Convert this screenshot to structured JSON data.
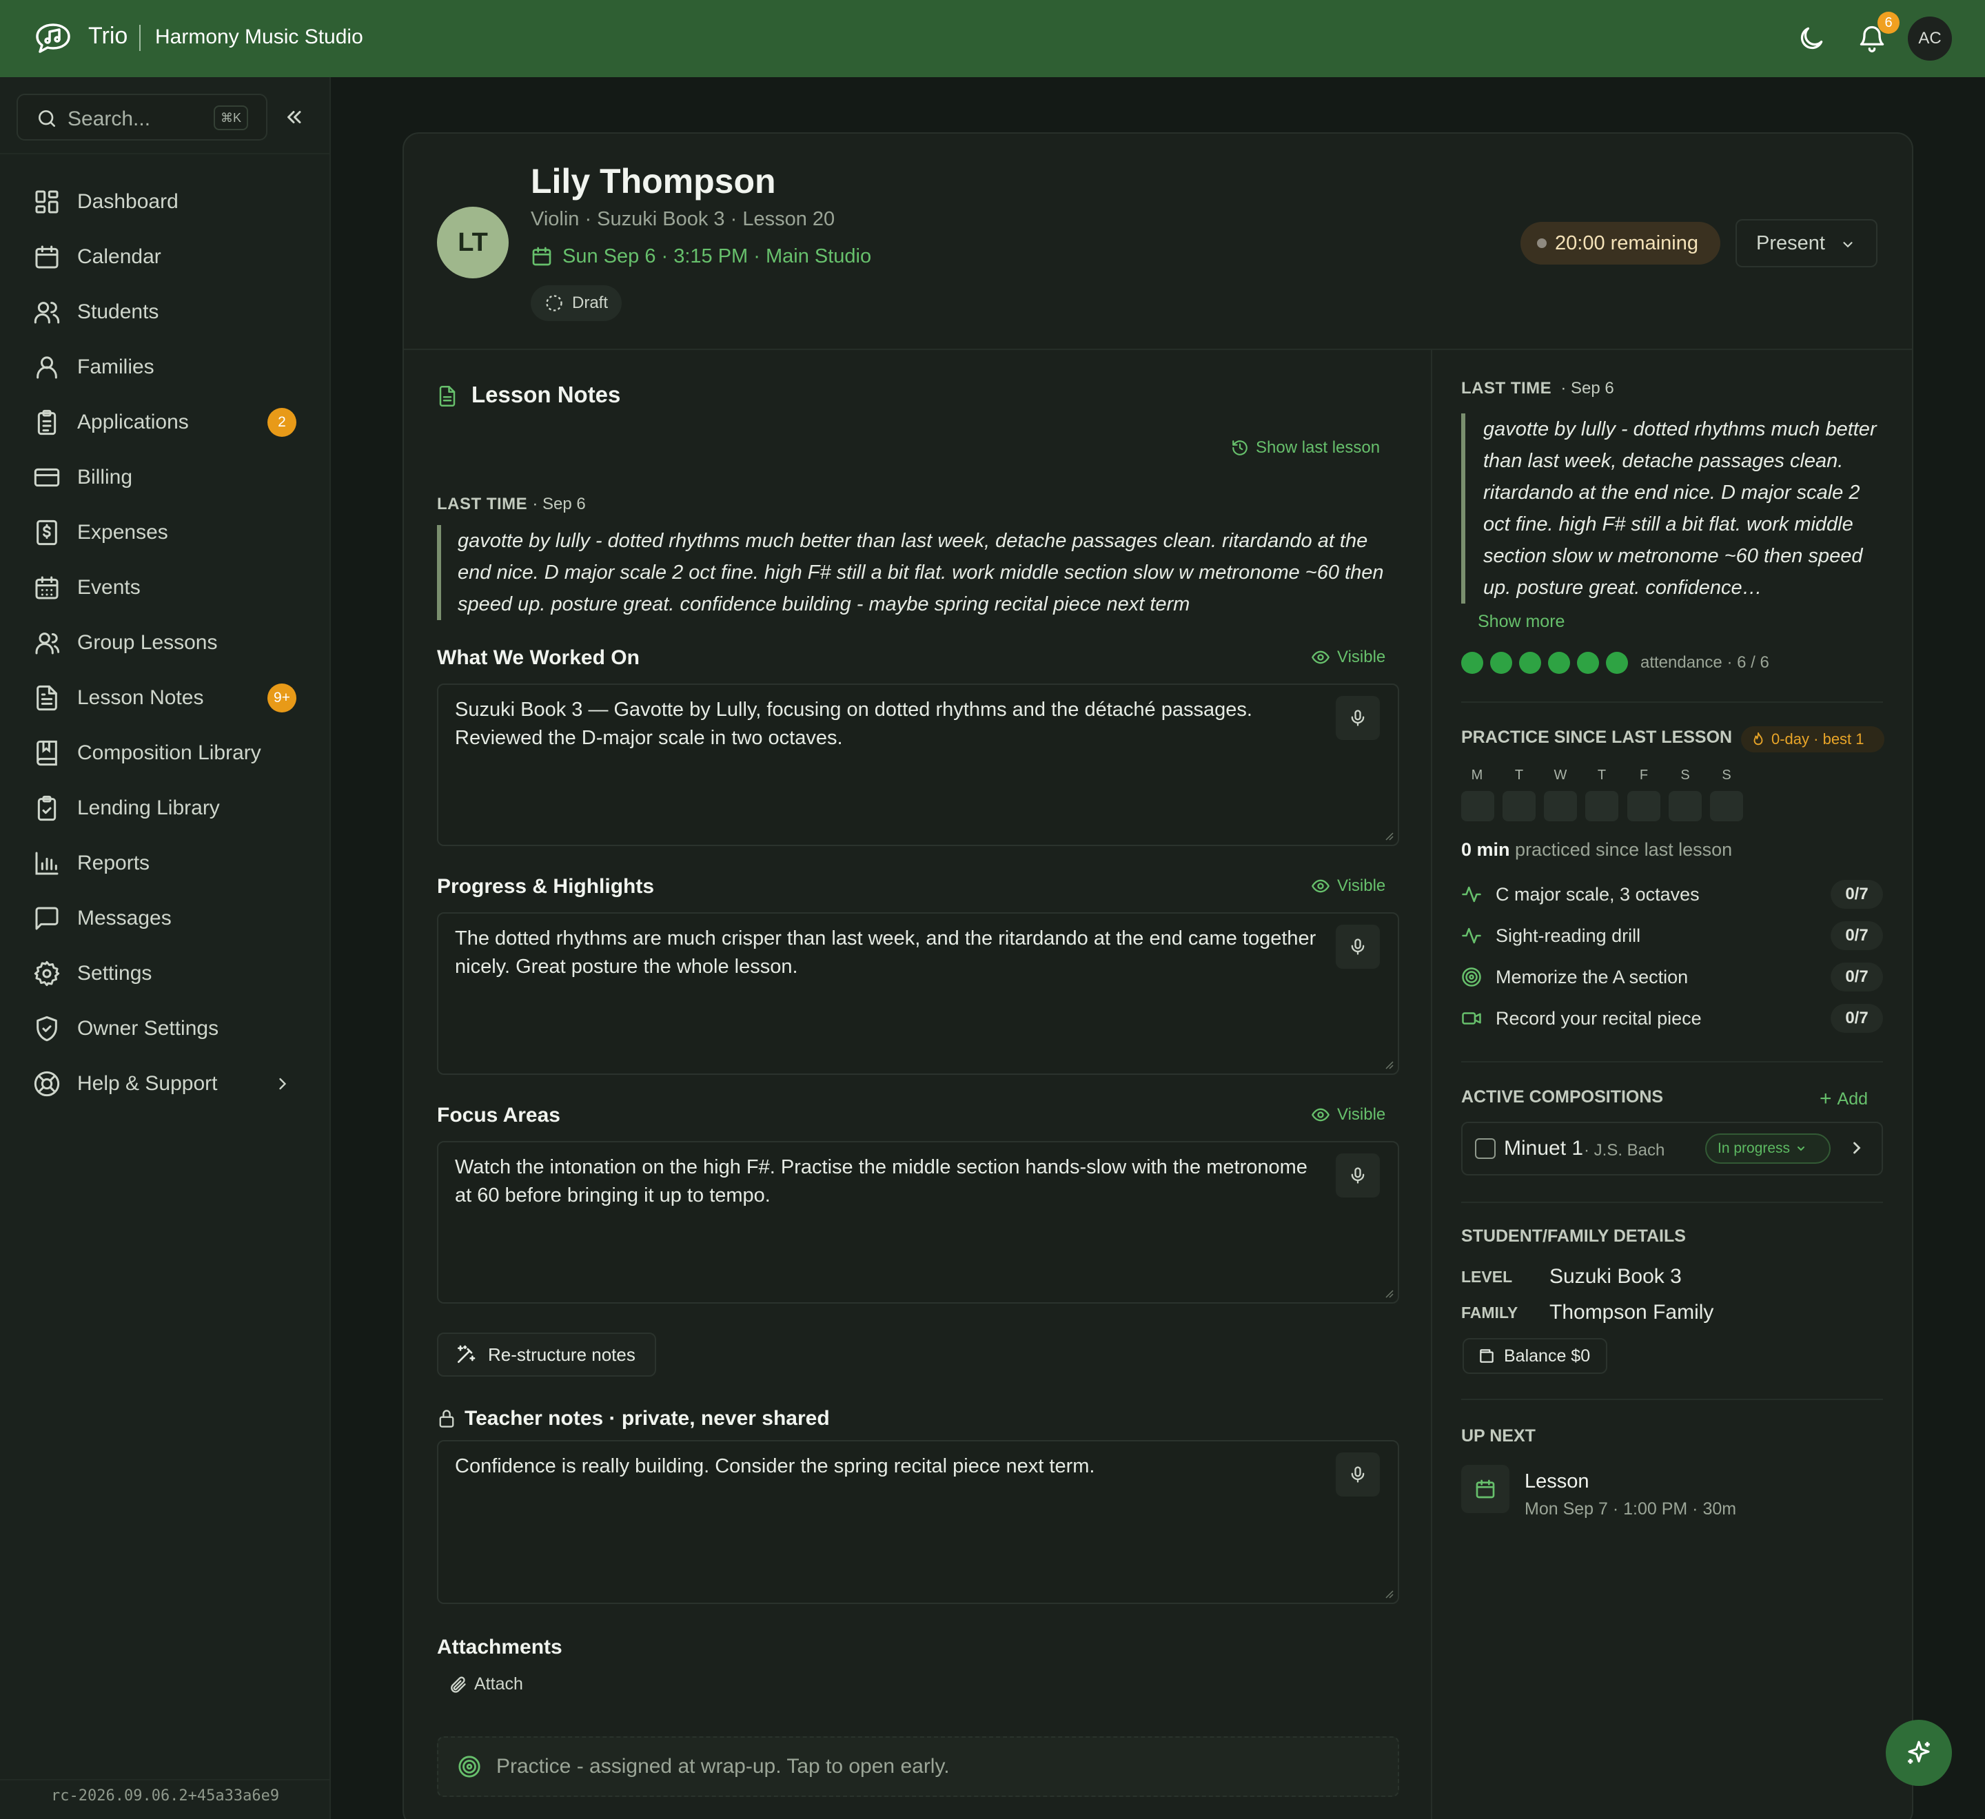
{
  "topbar": {
    "brand": "Trio",
    "studio": "Harmony Music Studio",
    "notification_count": "6",
    "avatar_initials": "AC"
  },
  "sidebar": {
    "search_placeholder": "Search...",
    "search_shortcut": "⌘K",
    "items": [
      {
        "label": "Dashboard",
        "icon": "dashboard-icon"
      },
      {
        "label": "Calendar",
        "icon": "calendar-icon"
      },
      {
        "label": "Students",
        "icon": "users-icon"
      },
      {
        "label": "Families",
        "icon": "user-icon"
      },
      {
        "label": "Applications",
        "icon": "clipboard-icon",
        "badge": "2"
      },
      {
        "label": "Billing",
        "icon": "credit-card-icon"
      },
      {
        "label": "Expenses",
        "icon": "receipt-icon"
      },
      {
        "label": "Events",
        "icon": "calendar-grid-icon"
      },
      {
        "label": "Group Lessons",
        "icon": "group-icon"
      },
      {
        "label": "Lesson Notes",
        "icon": "notes-icon",
        "badge": "9+"
      },
      {
        "label": "Composition Library",
        "icon": "book-icon"
      },
      {
        "label": "Lending Library",
        "icon": "clipboard-check-icon"
      },
      {
        "label": "Reports",
        "icon": "bar-chart-icon"
      },
      {
        "label": "Messages",
        "icon": "message-icon"
      },
      {
        "label": "Settings",
        "icon": "gear-icon"
      },
      {
        "label": "Owner Settings",
        "icon": "shield-icon"
      },
      {
        "label": "Help & Support",
        "icon": "lifebuoy-icon"
      }
    ],
    "version": "rc-2026.09.06.2+45a33a6e9"
  },
  "lesson": {
    "initials": "LT",
    "student_name": "Lily Thompson",
    "subtitle": "Violin · Suzuki Book 3 · Lesson 20",
    "schedule": "Sun Sep 6 · 3:15 PM · Main Studio",
    "status": "Draft",
    "timer": "20:00 remaining",
    "attendance_select": "Present"
  },
  "notes": {
    "title": "Lesson Notes",
    "show_last_lesson": "Show last lesson",
    "last_time_label": "LAST TIME",
    "last_time_date": "· Sep 6",
    "last_time_text": "gavotte by lully - dotted rhythms much better than last week, detache passages clean. ritardando at the end nice. D major scale 2 oct fine. high F# still a bit flat. work middle section slow w metronome ~60 then speed up. posture great. confidence building - maybe spring recital piece next term",
    "visible_label": "Visible",
    "fields": [
      {
        "label": "What We Worked On",
        "value": "Suzuki Book 3 — Gavotte by Lully, focusing on dotted rhythms and the détaché passages. Reviewed the D-major scale in two octaves."
      },
      {
        "label": "Progress & Highlights",
        "value": "The dotted rhythms are much crisper than last week, and the ritardando at the end came together nicely. Great posture the whole lesson."
      },
      {
        "label": "Focus Areas",
        "value": "Watch the intonation on the high F#. Practise the middle section hands-slow with the metronome at 60 before bringing it up to tempo."
      }
    ],
    "restructure_button": "Re-structure notes",
    "teacher_notes_label": "Teacher notes · private, never shared",
    "teacher_notes_value": "Confidence is really building. Consider the spring recital piece next term.",
    "attachments_label": "Attachments",
    "attach_button": "Attach",
    "practice_bar": "Practice - assigned at wrap-up. Tap to open early."
  },
  "right_panel": {
    "last_time_label": "LAST TIME",
    "last_time_date": "· Sep 6",
    "last_time_text": "gavotte by lully - dotted rhythms much better than last week, detache passages clean. ritardando at the end nice. D major scale 2 oct fine. high F# still a bit flat. work middle section slow w metronome ~60 then speed up. posture great. confidence…",
    "show_more": "Show more",
    "attendance_label": "attendance · 6 / 6",
    "attendance_attended": 6,
    "attendance_total": 6,
    "attendance_color": "#2ea343",
    "practice_title": "PRACTICE SINCE LAST LESSON",
    "streak": "0-day · best 1",
    "days": [
      "M",
      "T",
      "W",
      "T",
      "F",
      "S",
      "S"
    ],
    "minutes_bold": "0 min",
    "minutes_rest": "practiced since last lesson",
    "tasks": [
      {
        "label": "C major scale, 3 octaves",
        "count": "0/7",
        "icon": "activity-icon"
      },
      {
        "label": "Sight-reading drill",
        "count": "0/7",
        "icon": "activity-icon"
      },
      {
        "label": "Memorize the A section",
        "count": "0/7",
        "icon": "target-icon"
      },
      {
        "label": "Record your recital piece",
        "count": "0/7",
        "icon": "video-icon"
      }
    ],
    "compositions_title": "ACTIVE COMPOSITIONS",
    "add_label": "Add",
    "composition": {
      "title": "Minuet 1",
      "composer": "· J.S. Bach",
      "status": "In progress"
    },
    "details_title": "STUDENT/FAMILY DETAILS",
    "level_key": "LEVEL",
    "level_value": "Suzuki Book 3",
    "family_key": "FAMILY",
    "family_value": "Thompson Family",
    "balance": "Balance $0",
    "up_next_title": "UP NEXT",
    "up_next_name": "Lesson",
    "up_next_time": "Mon Sep 7 · 1:00 PM · 30m"
  },
  "colors": {
    "topbar": "#2f5f33",
    "accent_green": "#67c06c",
    "badge_orange": "#e89a18",
    "background": "#141a16"
  }
}
